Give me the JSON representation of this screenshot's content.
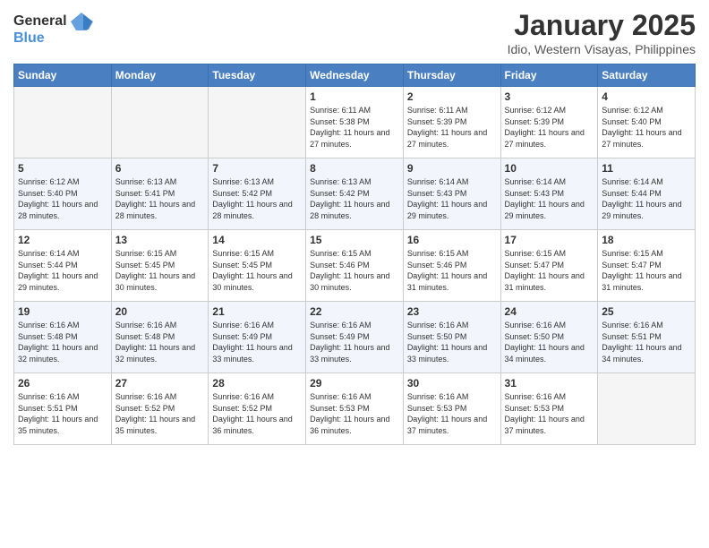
{
  "header": {
    "logo_line1": "General",
    "logo_line2": "Blue",
    "month_title": "January 2025",
    "location": "Idio, Western Visayas, Philippines"
  },
  "days_of_week": [
    "Sunday",
    "Monday",
    "Tuesday",
    "Wednesday",
    "Thursday",
    "Friday",
    "Saturday"
  ],
  "weeks": [
    [
      {
        "day": "",
        "sunrise": "",
        "sunset": "",
        "daylight": ""
      },
      {
        "day": "",
        "sunrise": "",
        "sunset": "",
        "daylight": ""
      },
      {
        "day": "",
        "sunrise": "",
        "sunset": "",
        "daylight": ""
      },
      {
        "day": "1",
        "sunrise": "Sunrise: 6:11 AM",
        "sunset": "Sunset: 5:38 PM",
        "daylight": "Daylight: 11 hours and 27 minutes."
      },
      {
        "day": "2",
        "sunrise": "Sunrise: 6:11 AM",
        "sunset": "Sunset: 5:39 PM",
        "daylight": "Daylight: 11 hours and 27 minutes."
      },
      {
        "day": "3",
        "sunrise": "Sunrise: 6:12 AM",
        "sunset": "Sunset: 5:39 PM",
        "daylight": "Daylight: 11 hours and 27 minutes."
      },
      {
        "day": "4",
        "sunrise": "Sunrise: 6:12 AM",
        "sunset": "Sunset: 5:40 PM",
        "daylight": "Daylight: 11 hours and 27 minutes."
      }
    ],
    [
      {
        "day": "5",
        "sunrise": "Sunrise: 6:12 AM",
        "sunset": "Sunset: 5:40 PM",
        "daylight": "Daylight: 11 hours and 28 minutes."
      },
      {
        "day": "6",
        "sunrise": "Sunrise: 6:13 AM",
        "sunset": "Sunset: 5:41 PM",
        "daylight": "Daylight: 11 hours and 28 minutes."
      },
      {
        "day": "7",
        "sunrise": "Sunrise: 6:13 AM",
        "sunset": "Sunset: 5:42 PM",
        "daylight": "Daylight: 11 hours and 28 minutes."
      },
      {
        "day": "8",
        "sunrise": "Sunrise: 6:13 AM",
        "sunset": "Sunset: 5:42 PM",
        "daylight": "Daylight: 11 hours and 28 minutes."
      },
      {
        "day": "9",
        "sunrise": "Sunrise: 6:14 AM",
        "sunset": "Sunset: 5:43 PM",
        "daylight": "Daylight: 11 hours and 29 minutes."
      },
      {
        "day": "10",
        "sunrise": "Sunrise: 6:14 AM",
        "sunset": "Sunset: 5:43 PM",
        "daylight": "Daylight: 11 hours and 29 minutes."
      },
      {
        "day": "11",
        "sunrise": "Sunrise: 6:14 AM",
        "sunset": "Sunset: 5:44 PM",
        "daylight": "Daylight: 11 hours and 29 minutes."
      }
    ],
    [
      {
        "day": "12",
        "sunrise": "Sunrise: 6:14 AM",
        "sunset": "Sunset: 5:44 PM",
        "daylight": "Daylight: 11 hours and 29 minutes."
      },
      {
        "day": "13",
        "sunrise": "Sunrise: 6:15 AM",
        "sunset": "Sunset: 5:45 PM",
        "daylight": "Daylight: 11 hours and 30 minutes."
      },
      {
        "day": "14",
        "sunrise": "Sunrise: 6:15 AM",
        "sunset": "Sunset: 5:45 PM",
        "daylight": "Daylight: 11 hours and 30 minutes."
      },
      {
        "day": "15",
        "sunrise": "Sunrise: 6:15 AM",
        "sunset": "Sunset: 5:46 PM",
        "daylight": "Daylight: 11 hours and 30 minutes."
      },
      {
        "day": "16",
        "sunrise": "Sunrise: 6:15 AM",
        "sunset": "Sunset: 5:46 PM",
        "daylight": "Daylight: 11 hours and 31 minutes."
      },
      {
        "day": "17",
        "sunrise": "Sunrise: 6:15 AM",
        "sunset": "Sunset: 5:47 PM",
        "daylight": "Daylight: 11 hours and 31 minutes."
      },
      {
        "day": "18",
        "sunrise": "Sunrise: 6:15 AM",
        "sunset": "Sunset: 5:47 PM",
        "daylight": "Daylight: 11 hours and 31 minutes."
      }
    ],
    [
      {
        "day": "19",
        "sunrise": "Sunrise: 6:16 AM",
        "sunset": "Sunset: 5:48 PM",
        "daylight": "Daylight: 11 hours and 32 minutes."
      },
      {
        "day": "20",
        "sunrise": "Sunrise: 6:16 AM",
        "sunset": "Sunset: 5:48 PM",
        "daylight": "Daylight: 11 hours and 32 minutes."
      },
      {
        "day": "21",
        "sunrise": "Sunrise: 6:16 AM",
        "sunset": "Sunset: 5:49 PM",
        "daylight": "Daylight: 11 hours and 33 minutes."
      },
      {
        "day": "22",
        "sunrise": "Sunrise: 6:16 AM",
        "sunset": "Sunset: 5:49 PM",
        "daylight": "Daylight: 11 hours and 33 minutes."
      },
      {
        "day": "23",
        "sunrise": "Sunrise: 6:16 AM",
        "sunset": "Sunset: 5:50 PM",
        "daylight": "Daylight: 11 hours and 33 minutes."
      },
      {
        "day": "24",
        "sunrise": "Sunrise: 6:16 AM",
        "sunset": "Sunset: 5:50 PM",
        "daylight": "Daylight: 11 hours and 34 minutes."
      },
      {
        "day": "25",
        "sunrise": "Sunrise: 6:16 AM",
        "sunset": "Sunset: 5:51 PM",
        "daylight": "Daylight: 11 hours and 34 minutes."
      }
    ],
    [
      {
        "day": "26",
        "sunrise": "Sunrise: 6:16 AM",
        "sunset": "Sunset: 5:51 PM",
        "daylight": "Daylight: 11 hours and 35 minutes."
      },
      {
        "day": "27",
        "sunrise": "Sunrise: 6:16 AM",
        "sunset": "Sunset: 5:52 PM",
        "daylight": "Daylight: 11 hours and 35 minutes."
      },
      {
        "day": "28",
        "sunrise": "Sunrise: 6:16 AM",
        "sunset": "Sunset: 5:52 PM",
        "daylight": "Daylight: 11 hours and 36 minutes."
      },
      {
        "day": "29",
        "sunrise": "Sunrise: 6:16 AM",
        "sunset": "Sunset: 5:53 PM",
        "daylight": "Daylight: 11 hours and 36 minutes."
      },
      {
        "day": "30",
        "sunrise": "Sunrise: 6:16 AM",
        "sunset": "Sunset: 5:53 PM",
        "daylight": "Daylight: 11 hours and 37 minutes."
      },
      {
        "day": "31",
        "sunrise": "Sunrise: 6:16 AM",
        "sunset": "Sunset: 5:53 PM",
        "daylight": "Daylight: 11 hours and 37 minutes."
      },
      {
        "day": "",
        "sunrise": "",
        "sunset": "",
        "daylight": ""
      }
    ]
  ]
}
